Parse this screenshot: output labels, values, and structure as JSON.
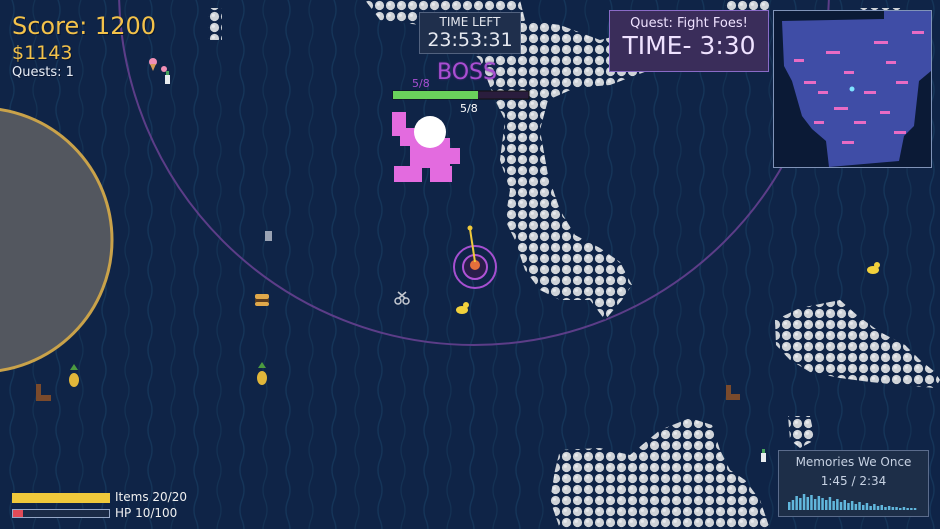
{
  "hud": {
    "score": "Score: 1200",
    "money": "$1143",
    "quests": "Quests: 1"
  },
  "timer": {
    "label": "TIME LEFT",
    "value": "23:53:31"
  },
  "quest": {
    "title": "Quest: Fight Foes!",
    "time": "TIME- 3:30"
  },
  "boss": {
    "name": "BOSS",
    "count": "5/8",
    "health_fraction": 0.625
  },
  "music": {
    "title": "Memories We Once",
    "time": "1:45 / 2:34"
  },
  "player": {
    "items_label": "Items 20/20",
    "items_fraction": 1.0,
    "hp_label": "HP 10/100",
    "hp_fraction": 0.1
  },
  "colors": {
    "ocean": "#0f2447",
    "rock": "#c8cdd4",
    "boss": "#e36bdf",
    "hud_gold": "#f3c24a",
    "quest_purple": "#3a2d5a"
  },
  "icons": [
    "duck-icon",
    "pineapple-icon",
    "burger-icon",
    "scissors-icon",
    "trash-can-icon",
    "bottle-icon",
    "chair-icon",
    "ice-cream-icon"
  ]
}
